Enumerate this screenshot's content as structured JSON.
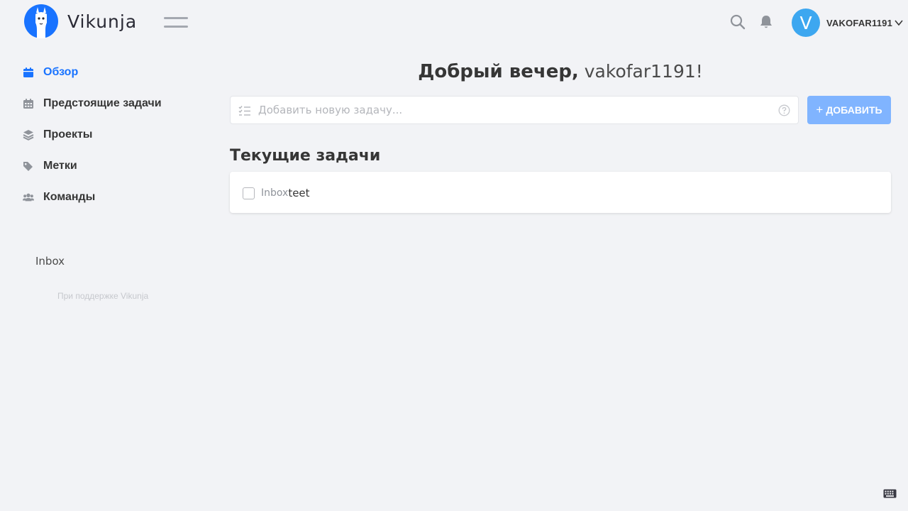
{
  "app": {
    "brand": "Vikunja"
  },
  "header": {
    "avatar_letter": "V",
    "username": "VAKOFAR1191"
  },
  "sidebar": {
    "items": [
      {
        "label": "Обзор",
        "icon": "calendar-icon",
        "active": true
      },
      {
        "label": "Предстоящие задачи",
        "icon": "calendar-grid-icon",
        "active": false
      },
      {
        "label": "Проекты",
        "icon": "layers-icon",
        "active": false
      },
      {
        "label": "Метки",
        "icon": "tags-icon",
        "active": false
      },
      {
        "label": "Команды",
        "icon": "users-icon",
        "active": false
      }
    ],
    "projects": [
      {
        "label": "Inbox"
      }
    ],
    "powered_by": "При поддержке Vikunja"
  },
  "main": {
    "greeting_prefix": "Добрый вечер,",
    "greeting_user": " vakofar1191!",
    "add_task": {
      "placeholder": "Добавить новую задачу...",
      "value": "",
      "button_label": "ДОБАВИТЬ"
    },
    "current_tasks_title": "Текущие задачи",
    "tasks": [
      {
        "project": "Inbox",
        "title": "teet",
        "done": false
      }
    ]
  },
  "colors": {
    "accent": "#1973ff",
    "add_button": "#80b4ff",
    "avatar": "#3da7f0",
    "background": "#f2f3f6"
  }
}
